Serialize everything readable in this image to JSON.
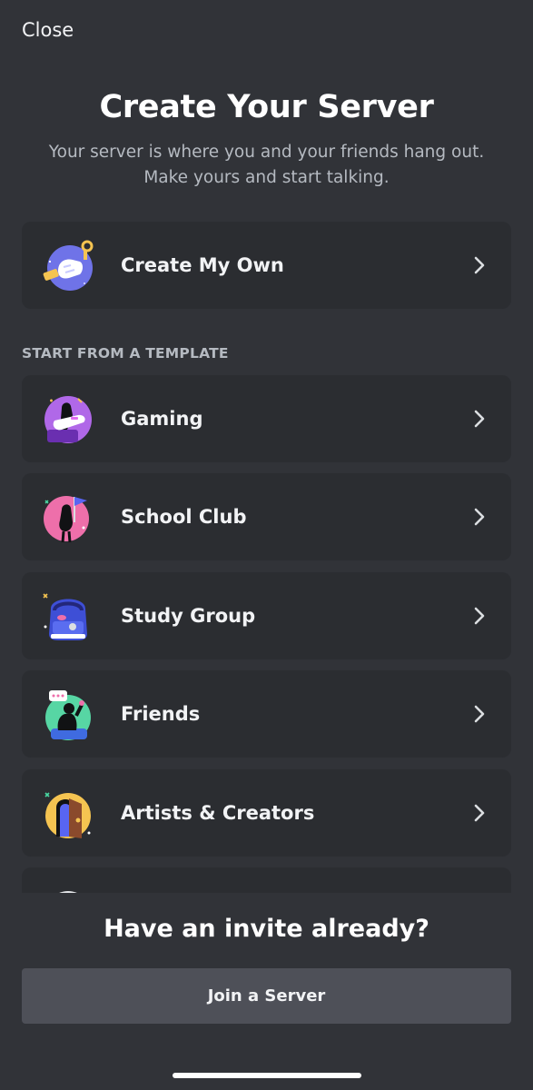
{
  "header": {
    "close_label": "Close",
    "title": "Create Your Server",
    "subtitle_line1": "Your server is where you and your friends hang out.",
    "subtitle_line2": "Make yours and start talking."
  },
  "create_own": {
    "label": "Create My Own",
    "icon": "create-own-icon"
  },
  "templates": {
    "section_label": "START FROM A TEMPLATE",
    "items": [
      {
        "label": "Gaming",
        "icon": "gaming-icon"
      },
      {
        "label": "School Club",
        "icon": "school-club-icon"
      },
      {
        "label": "Study Group",
        "icon": "study-group-icon"
      },
      {
        "label": "Friends",
        "icon": "friends-icon"
      },
      {
        "label": "Artists & Creators",
        "icon": "artists-creators-icon"
      }
    ]
  },
  "footer": {
    "invite_heading": "Have an invite already?",
    "join_button_label": "Join a Server"
  },
  "colors": {
    "background": "#313338",
    "card": "#2b2d31",
    "button": "#4e5058",
    "text_primary": "#f2f3f5",
    "text_secondary": "#b5bac1"
  }
}
